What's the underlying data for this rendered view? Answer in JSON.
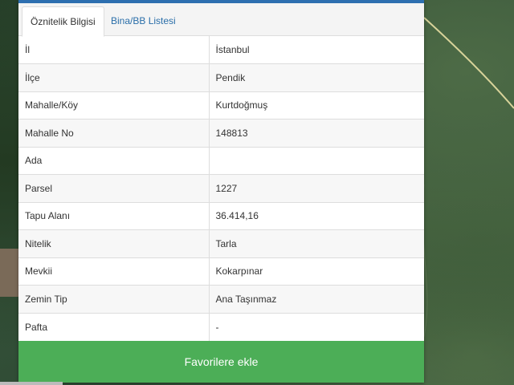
{
  "tabs": [
    {
      "label": "Öznitelik Bilgisi",
      "active": true
    },
    {
      "label": "Bina/BB Listesi",
      "active": false
    }
  ],
  "rows": [
    {
      "key": "İl",
      "value": "İstanbul"
    },
    {
      "key": "İlçe",
      "value": "Pendik"
    },
    {
      "key": "Mahalle/Köy",
      "value": "Kurtdoğmuş"
    },
    {
      "key": "Mahalle No",
      "value": "148813"
    },
    {
      "key": "Ada",
      "value": ""
    },
    {
      "key": "Parsel",
      "value": "1227"
    },
    {
      "key": "Tapu Alanı",
      "value": "36.414,16"
    },
    {
      "key": "Nitelik",
      "value": "Tarla"
    },
    {
      "key": "Mevkii",
      "value": "Kokarpınar"
    },
    {
      "key": "Zemin Tip",
      "value": "Ana Taşınmaz"
    },
    {
      "key": "Pafta",
      "value": "-"
    }
  ],
  "favorite_button": {
    "label": "Favorilere ekle"
  },
  "colors": {
    "accent": "#2d6fb0",
    "tab_link": "#2a6ea9",
    "button": "#4cae57"
  }
}
